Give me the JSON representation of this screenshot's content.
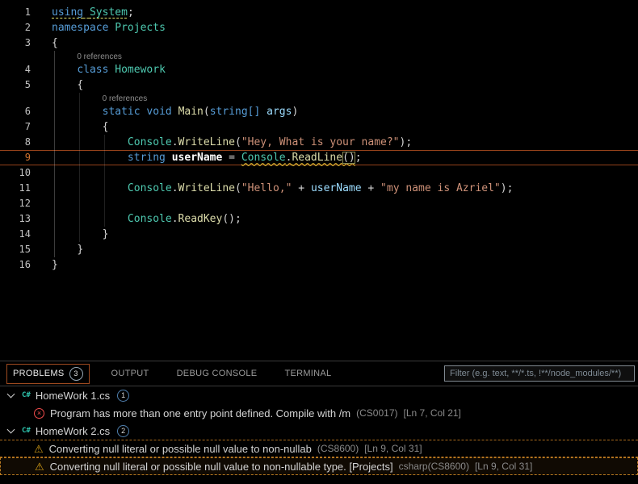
{
  "editor": {
    "codelens_label": "0 references",
    "lines": [
      {
        "num": "1",
        "indent": 0,
        "tokens": [
          {
            "t": "kw",
            "s": "using",
            "u": "dashed"
          },
          {
            "t": "plain",
            "s": " ",
            "u": "dashed"
          },
          {
            "t": "type",
            "s": "System",
            "u": "dashed"
          },
          {
            "t": "plain",
            "s": ";"
          }
        ]
      },
      {
        "num": "2",
        "indent": 0,
        "tokens": [
          {
            "t": "kw",
            "s": "namespace"
          },
          {
            "t": "plain",
            "s": " "
          },
          {
            "t": "type",
            "s": "Projects"
          }
        ]
      },
      {
        "num": "3",
        "indent": 0,
        "tokens": [
          {
            "t": "plain",
            "s": "{"
          }
        ]
      },
      {
        "type": "codelens",
        "indent": 4,
        "text": "0 references"
      },
      {
        "num": "4",
        "indent": 4,
        "tokens": [
          {
            "t": "kw",
            "s": "class"
          },
          {
            "t": "plain",
            "s": " "
          },
          {
            "t": "type",
            "s": "Homework"
          }
        ]
      },
      {
        "num": "5",
        "indent": 4,
        "tokens": [
          {
            "t": "plain",
            "s": "{"
          }
        ]
      },
      {
        "type": "codelens",
        "indent": 8,
        "text": "0 references"
      },
      {
        "num": "6",
        "indent": 8,
        "tokens": [
          {
            "t": "kw",
            "s": "static"
          },
          {
            "t": "plain",
            "s": " "
          },
          {
            "t": "kw",
            "s": "void"
          },
          {
            "t": "plain",
            "s": " "
          },
          {
            "t": "method",
            "s": "Main"
          },
          {
            "t": "plain",
            "s": "("
          },
          {
            "t": "kw",
            "s": "string[]"
          },
          {
            "t": "plain",
            "s": " "
          },
          {
            "t": "var",
            "s": "args"
          },
          {
            "t": "plain",
            "s": ")"
          }
        ]
      },
      {
        "num": "7",
        "indent": 8,
        "tokens": [
          {
            "t": "plain",
            "s": "{"
          }
        ]
      },
      {
        "num": "8",
        "indent": 12,
        "tokens": [
          {
            "t": "type",
            "s": "Console"
          },
          {
            "t": "plain",
            "s": "."
          },
          {
            "t": "method",
            "s": "WriteLine"
          },
          {
            "t": "plain",
            "s": "("
          },
          {
            "t": "str",
            "s": "\"Hey, What is your name?\""
          },
          {
            "t": "plain",
            "s": ");"
          }
        ]
      },
      {
        "num": "9",
        "indent": 12,
        "active": true,
        "tokens": [
          {
            "t": "kw",
            "s": "string"
          },
          {
            "t": "plain",
            "s": " "
          },
          {
            "t": "decl",
            "s": "userName"
          },
          {
            "t": "plain",
            "s": " = "
          },
          {
            "t": "type",
            "s": "Console",
            "u": "wavy"
          },
          {
            "t": "plain",
            "s": ".",
            "u": "wavy"
          },
          {
            "t": "method",
            "s": "ReadLine",
            "u": "wavy"
          },
          {
            "t": "plain",
            "s": "()",
            "u": "wavy",
            "bracket": true
          },
          {
            "t": "plain",
            "s": ";"
          }
        ]
      },
      {
        "num": "10",
        "indent": 0,
        "tokens": []
      },
      {
        "num": "11",
        "indent": 12,
        "tokens": [
          {
            "t": "type",
            "s": "Console"
          },
          {
            "t": "plain",
            "s": "."
          },
          {
            "t": "method",
            "s": "WriteLine"
          },
          {
            "t": "plain",
            "s": "("
          },
          {
            "t": "str",
            "s": "\"Hello,\""
          },
          {
            "t": "plain",
            "s": " + "
          },
          {
            "t": "var",
            "s": "userName"
          },
          {
            "t": "plain",
            "s": " + "
          },
          {
            "t": "str",
            "s": "\"my name is Azriel\""
          },
          {
            "t": "plain",
            "s": ");"
          }
        ]
      },
      {
        "num": "12",
        "indent": 0,
        "tokens": []
      },
      {
        "num": "13",
        "indent": 12,
        "tokens": [
          {
            "t": "type",
            "s": "Console"
          },
          {
            "t": "plain",
            "s": "."
          },
          {
            "t": "method",
            "s": "ReadKey"
          },
          {
            "t": "plain",
            "s": "();"
          }
        ]
      },
      {
        "num": "14",
        "indent": 8,
        "tokens": [
          {
            "t": "plain",
            "s": "}"
          }
        ]
      },
      {
        "num": "15",
        "indent": 4,
        "tokens": [
          {
            "t": "plain",
            "s": "}"
          }
        ]
      },
      {
        "num": "16",
        "indent": 0,
        "tokens": [
          {
            "t": "plain",
            "s": "}"
          }
        ]
      }
    ]
  },
  "panel": {
    "tabs": [
      {
        "label": "PROBLEMS",
        "badge": "3",
        "active": true
      },
      {
        "label": "OUTPUT",
        "active": false
      },
      {
        "label": "DEBUG CONSOLE",
        "active": false
      },
      {
        "label": "TERMINAL",
        "active": false
      }
    ],
    "filter_placeholder": "Filter (e.g. text, **/*.ts, !**/node_modules/**)",
    "tree": [
      {
        "type": "file",
        "label": "HomeWork 1.cs",
        "count": "1"
      },
      {
        "type": "error",
        "message": "Program has more than one entry point defined. Compile with /m",
        "code": "(CS0017)",
        "location": "[Ln 7, Col 21]"
      },
      {
        "type": "file",
        "label": "HomeWork 2.cs",
        "count": "2"
      },
      {
        "type": "warning",
        "message": "Converting null literal or possible null value to non-nullab",
        "code": "(CS8600)",
        "location": "[Ln 9, Col 31]",
        "outlined": true
      },
      {
        "type": "warning",
        "message": "Converting null literal or possible null value to non-nullable type. [Projects]",
        "code": "csharp(CS8600)",
        "location": "[Ln 9, Col 31]",
        "selected": true
      }
    ]
  },
  "colors": {
    "background": "#000000",
    "keyword": "#569cd6",
    "type": "#4ec9b0",
    "method": "#dcdcaa",
    "string": "#ce9178",
    "variable": "#9cdcfe",
    "active_line_border": "#95421a",
    "error": "#f14c4c",
    "warning": "#d7a017",
    "list_focus_dashed": "#b97a20"
  }
}
